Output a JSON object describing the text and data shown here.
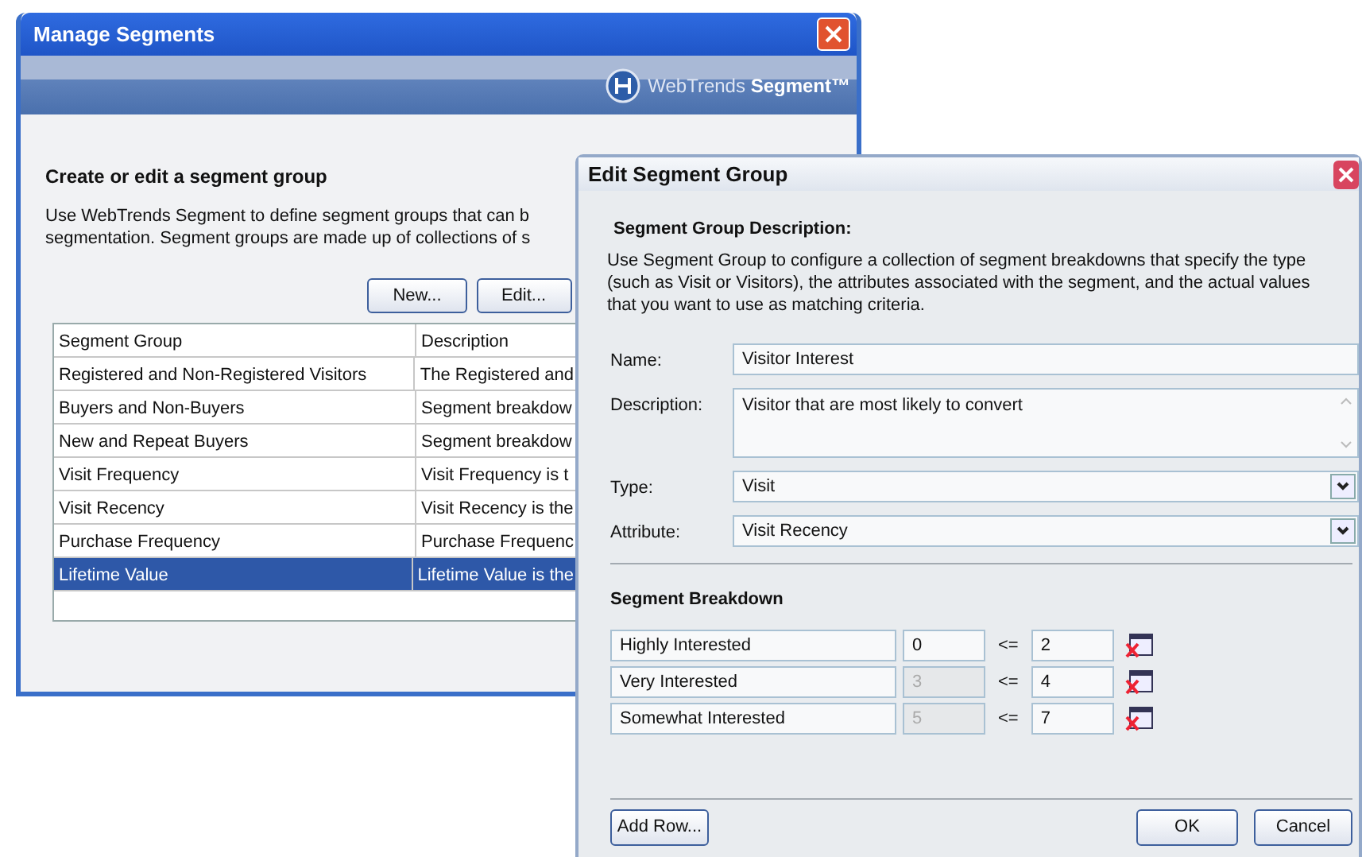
{
  "manage_window": {
    "title": "Manage Segments",
    "brand": {
      "name": "WebTrends",
      "product": "Segment",
      "mark": "™"
    },
    "heading": "Create or edit a segment group",
    "description_lines": [
      "Use WebTrends Segment to define segment groups that can b",
      "segmentation. Segment groups are made up of collections of s"
    ],
    "buttons": [
      "New...",
      "Edit..."
    ],
    "table": {
      "columns": [
        "Segment Group",
        "Description"
      ],
      "rows": [
        {
          "cells": [
            "Registered and Non-Registered Visitors",
            "The Registered and"
          ],
          "selected": false
        },
        {
          "cells": [
            "Buyers and Non-Buyers",
            "Segment breakdow"
          ],
          "selected": false
        },
        {
          "cells": [
            "New and Repeat Buyers",
            "Segment breakdow"
          ],
          "selected": false
        },
        {
          "cells": [
            "Visit Frequency",
            "Visit Frequency is t"
          ],
          "selected": false
        },
        {
          "cells": [
            "Visit Recency",
            "Visit Recency is the"
          ],
          "selected": false
        },
        {
          "cells": [
            "Purchase Frequency",
            "Purchase Frequenc"
          ],
          "selected": false
        },
        {
          "cells": [
            "Lifetime Value",
            "Lifetime Value is the"
          ],
          "selected": true
        }
      ]
    }
  },
  "edit_window": {
    "title": "Edit Segment Group",
    "section_title": "Segment Group Description:",
    "intro": "Use Segment Group to configure a collection of segment breakdowns that specify the type (such as Visit or Visitors), the attributes associated with the segment, and the actual values that you want to use as matching criteria.",
    "fields": [
      {
        "kind": "text",
        "label": "Name:",
        "value": "Visitor Interest"
      },
      {
        "kind": "textarea",
        "label": "Description:",
        "value": "Visitor that are most likely to convert"
      },
      {
        "kind": "select",
        "label": "Type:",
        "value": "Visit"
      },
      {
        "kind": "select",
        "label": "Attribute:",
        "value": "Visit Recency"
      }
    ],
    "breakdown_title": "Segment Breakdown",
    "breakdown": [
      {
        "name": "Highly Interested",
        "min": "0",
        "min_disabled": false,
        "operator": "<=",
        "max": "2"
      },
      {
        "name": "Very Interested",
        "min": "3",
        "min_disabled": true,
        "operator": "<=",
        "max": "4"
      },
      {
        "name": "Somewhat Interested",
        "min": "5",
        "min_disabled": true,
        "operator": "<=",
        "max": "7"
      }
    ],
    "buttons": {
      "add_row": "Add Row...",
      "ok": "OK",
      "cancel": "Cancel"
    }
  }
}
